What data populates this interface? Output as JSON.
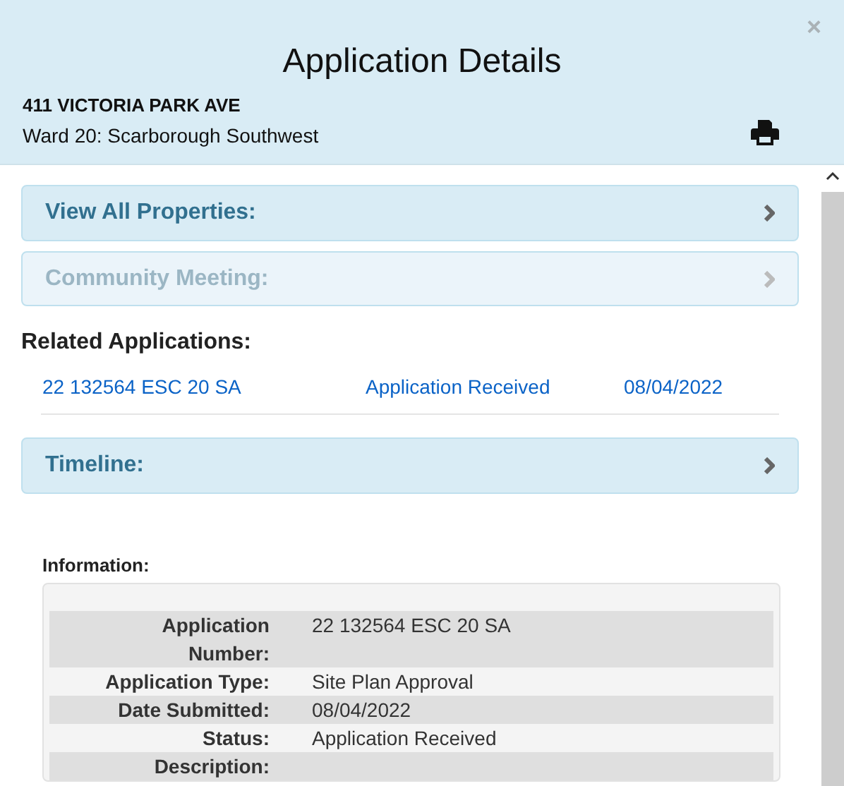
{
  "dialog": {
    "title": "Application Details",
    "address": "411 VICTORIA PARK AVE",
    "ward": "Ward 20: Scarborough Southwest",
    "close": "×"
  },
  "panels": [
    {
      "label": "View All Properties:",
      "disabled": false
    },
    {
      "label": "Community Meeting:",
      "disabled": true
    }
  ],
  "related_applications": {
    "heading": "Related Applications:",
    "rows": [
      {
        "number": "22 132564 ESC 20 SA",
        "status": "Application Received",
        "date": "08/04/2022"
      }
    ]
  },
  "timeline": {
    "label": "Timeline:",
    "disabled": false
  },
  "information": {
    "heading": "Information:",
    "rows": [
      {
        "label": "Application Number:",
        "value": "22 132564 ESC 20 SA"
      },
      {
        "label": "Application Type:",
        "value": "Site Plan Approval"
      },
      {
        "label": "Date Submitted:",
        "value": "08/04/2022"
      },
      {
        "label": "Status:",
        "value": "Application Received"
      },
      {
        "label": "Description:",
        "value": ""
      }
    ]
  }
}
